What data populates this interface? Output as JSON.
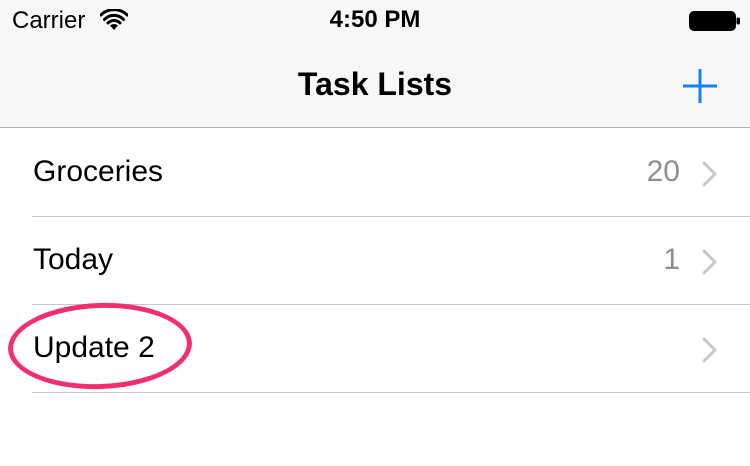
{
  "status_bar": {
    "carrier": "Carrier",
    "time": "4:50 PM",
    "icons": {
      "wifi": "wifi-icon",
      "battery": "battery-icon"
    }
  },
  "nav_bar": {
    "title": "Task Lists",
    "add_button_icon": "plus-icon",
    "accent_color": "#157efb"
  },
  "task_lists": [
    {
      "label": "Groceries",
      "count": "20"
    },
    {
      "label": "Today",
      "count": "1"
    },
    {
      "label": "Update 2",
      "count": ""
    }
  ],
  "annotation": {
    "highlight_color": "#f0306e",
    "highlighted_item": "Update 2"
  },
  "colors": {
    "bar_background": "#f7f7f7",
    "separator": "#c8c7cc",
    "secondary_text": "#8e8e93",
    "chevron": "#c7c7cc"
  }
}
